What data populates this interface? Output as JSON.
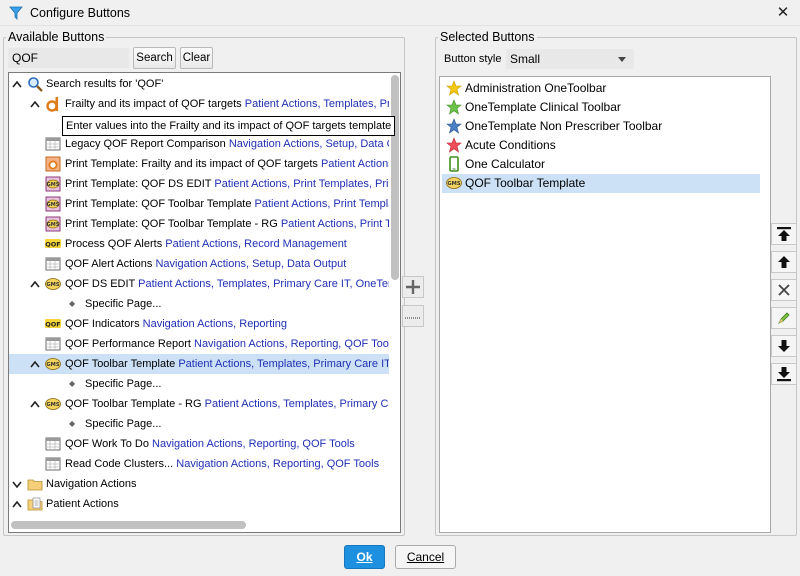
{
  "window": {
    "title": "Configure Buttons",
    "close_glyph": "✕",
    "icon": "filter-app-icon"
  },
  "available": {
    "legend": "Available Buttons",
    "search_value": "QOF",
    "search_button": "Search",
    "clear_button": "Clear",
    "tooltip": "Enter values into the Frailty and its impact of QOF targets template",
    "tree": [
      {
        "tog": "^",
        "icon": "search-icon",
        "name": "Search results for 'QOF'",
        "cats": ""
      },
      {
        "tog": "^",
        "icon": "orange-d-template-icon",
        "name": "Frailty and its impact of QOF targets",
        "cats": "Patient Actions, Templates, Pri"
      },
      {
        "tog": "",
        "icon": "tooltip-spacer",
        "name": "",
        "cats": ""
      },
      {
        "tog": "",
        "icon": "report-grid-icon",
        "name": "Legacy QOF Report Comparison",
        "cats": "Navigation Actions, Setup, Data Ou"
      },
      {
        "tog": "",
        "icon": "orange-print-template-icon",
        "name": "Print Template: Frailty and its impact of QOF targets",
        "cats": "Patient Actions,"
      },
      {
        "tog": "",
        "icon": "gms-print-icon",
        "name": "Print Template: QOF DS EDIT",
        "cats": "Patient Actions, Print Templates, Prima"
      },
      {
        "tog": "",
        "icon": "gms-print-icon",
        "name": "Print Template: QOF Toolbar Template",
        "cats": "Patient Actions, Print Templat"
      },
      {
        "tog": "",
        "icon": "gms-print-icon",
        "name": "Print Template: QOF Toolbar Template - RG",
        "cats": "Patient Actions, Print Te"
      },
      {
        "tog": "",
        "icon": "qof-label-icon",
        "name": "Process QOF Alerts",
        "cats": "Patient Actions, Record Management"
      },
      {
        "tog": "",
        "icon": "report-grid-icon",
        "name": "QOF Alert Actions",
        "cats": "Navigation Actions, Setup, Data Output"
      },
      {
        "tog": "^",
        "icon": "gms-oval-icon",
        "name": "QOF DS EDIT",
        "cats": "Patient Actions, Templates, Primary Care IT, OneTemp"
      },
      {
        "tog": "",
        "icon": "bullet-icon",
        "name": "Specific Page...",
        "cats": ""
      },
      {
        "tog": "",
        "icon": "qof-label-icon",
        "name": "QOF Indicators",
        "cats": "Navigation Actions, Reporting"
      },
      {
        "tog": "",
        "icon": "report-grid-icon",
        "name": "QOF Performance Report",
        "cats": "Navigation Actions, Reporting, QOF Tools"
      },
      {
        "tog": "^",
        "icon": "gms-oval-icon",
        "name": "QOF Toolbar Template",
        "cats": "Patient Actions, Templates, Primary Care IT,"
      },
      {
        "tog": "",
        "icon": "bullet-icon",
        "name": "Specific Page...",
        "cats": ""
      },
      {
        "tog": "^",
        "icon": "gms-oval-icon",
        "name": "QOF Toolbar Template - RG",
        "cats": "Patient Actions, Templates, Primary Car"
      },
      {
        "tog": "",
        "icon": "bullet-icon",
        "name": "Specific Page...",
        "cats": ""
      },
      {
        "tog": "",
        "icon": "report-grid-icon",
        "name": "QOF Work To Do",
        "cats": "Navigation Actions, Reporting, QOF Tools"
      },
      {
        "tog": "",
        "icon": "report-grid-icon",
        "name": "Read Code Clusters...",
        "cats": "Navigation Actions, Reporting, QOF Tools"
      },
      {
        "tog": "v",
        "icon": "folder-icon",
        "name": "Navigation Actions",
        "cats": ""
      },
      {
        "tog": "^",
        "icon": "folder-doc-icon",
        "name": "Patient Actions",
        "cats": ""
      }
    ]
  },
  "selected": {
    "legend": "Selected Buttons",
    "style_label": "Button style",
    "style_value": "Small",
    "items": [
      {
        "icon": "yellow-star-icon",
        "label": "Administration OneToolbar"
      },
      {
        "icon": "green-star-icon",
        "label": "OneTemplate Clinical Toolbar"
      },
      {
        "icon": "blue-star-icon",
        "label": "OneTemplate Non Prescriber Toolbar"
      },
      {
        "icon": "red-star-icon",
        "label": "Acute Conditions"
      },
      {
        "icon": "phone-icon",
        "label": "One Calculator"
      },
      {
        "icon": "gms-oval-icon",
        "label": "QOF Toolbar Template"
      }
    ]
  },
  "footer": {
    "ok": "Ok",
    "cancel": "Cancel"
  },
  "colors": {
    "category_link": "#1f2fb4",
    "selection": "#cce1f6",
    "ok_blue": "#1e90e0"
  }
}
